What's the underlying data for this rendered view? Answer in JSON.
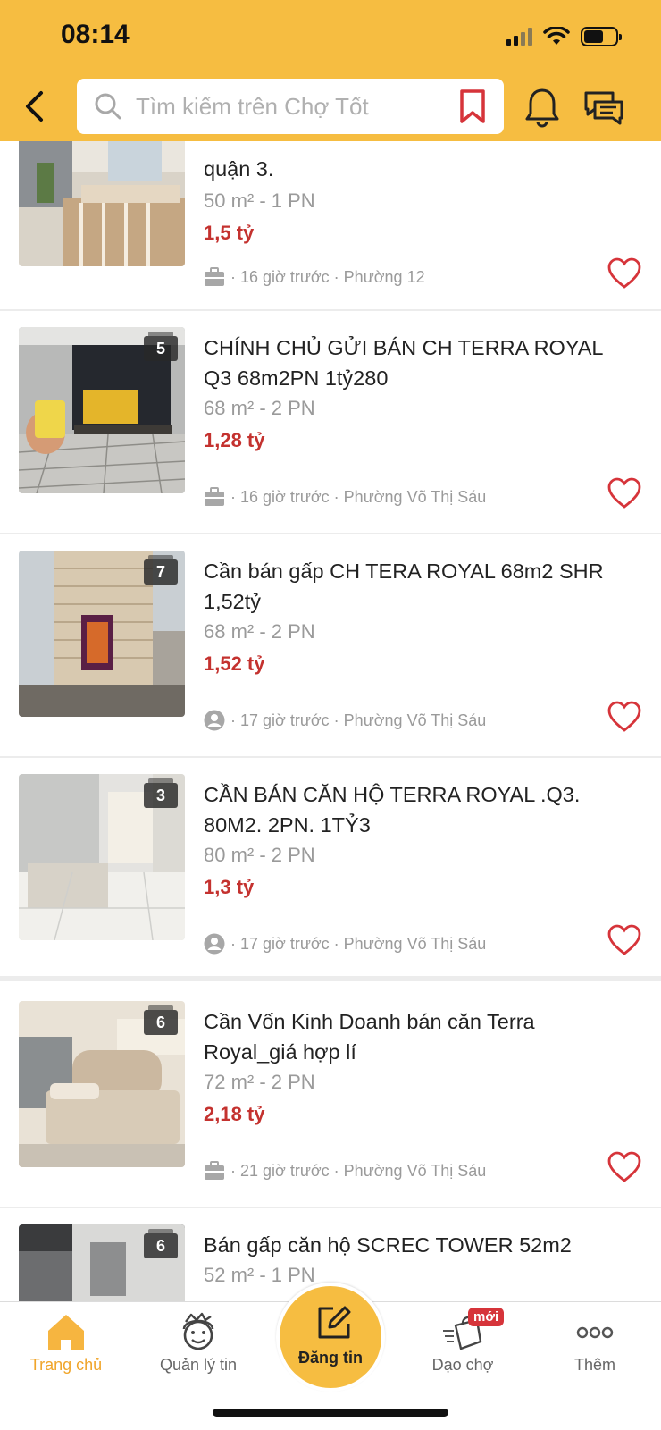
{
  "status_bar": {
    "time": "08:14"
  },
  "header": {
    "search_placeholder": "Tìm kiếm trên Chợ Tốt",
    "bg_color": "#f6bd41"
  },
  "listings": [
    {
      "title": "quận 3.",
      "meta": "50 m² - 1 PN",
      "price": "1,5 tỷ",
      "footer": "· 16 giờ trước · Phường 12",
      "seller_icon": "briefcase-icon",
      "image_count": ""
    },
    {
      "title": "CHÍNH CHỦ GỬI BÁN CH TERRA ROYAL Q3 68m2PN 1tỷ280",
      "meta": "68 m² - 2 PN",
      "price": "1,28 tỷ",
      "footer": "· 16 giờ trước · Phường Võ Thị Sáu",
      "seller_icon": "briefcase-icon",
      "image_count": "5"
    },
    {
      "title": "Cần bán gấp CH TERA ROYAL 68m2 SHR 1,52tỷ",
      "meta": "68 m² - 2 PN",
      "price": "1,52 tỷ",
      "footer": "· 17 giờ trước · Phường Võ Thị Sáu",
      "seller_icon": "user-icon",
      "image_count": "7"
    },
    {
      "title": "CẦN BÁN CĂN HỘ TERRA ROYAL .Q3. 80M2. 2PN. 1TỶ3",
      "meta": "80 m² - 2 PN",
      "price": "1,3 tỷ",
      "footer": "· 17 giờ trước · Phường Võ Thị Sáu",
      "seller_icon": "user-icon",
      "image_count": "3"
    },
    {
      "title": "Cần Vốn Kinh Doanh bán căn Terra Royal_giá hợp lí",
      "meta": "72 m² - 2 PN",
      "price": "2,18 tỷ",
      "footer": "· 21 giờ trước · Phường Võ Thị Sáu",
      "seller_icon": "briefcase-icon",
      "image_count": "6"
    },
    {
      "title": "Bán gấp căn hộ SCREC TOWER 52m2",
      "meta": "52 m² - 1 PN",
      "price": "",
      "footer": "",
      "seller_icon": "",
      "image_count": "6"
    }
  ],
  "bottom_nav": {
    "home": "Trang chủ",
    "manage": "Quản lý tin",
    "post": "Đăng tin",
    "market": "Dạo chợ",
    "more": "Thêm",
    "new_badge": "mới"
  },
  "colors": {
    "price": "#c4322f",
    "accent": "#f6bd41",
    "active_nav": "#f0a52a"
  }
}
